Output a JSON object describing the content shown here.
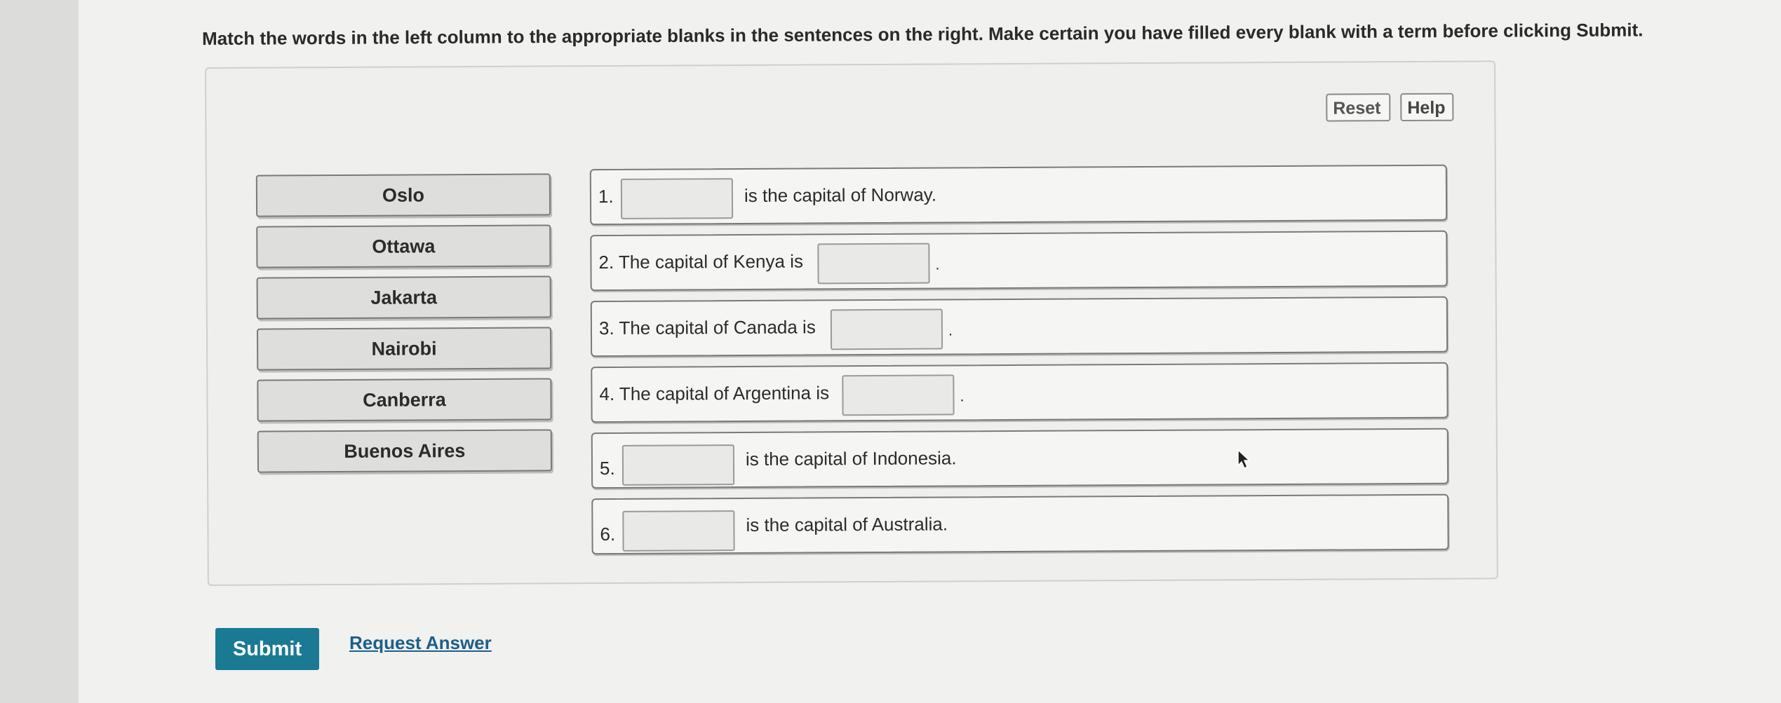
{
  "instructions": "Match the words in the left column to the appropriate blanks in the sentences on the right. Make certain you have filled every blank with a term before clicking Submit.",
  "toolbar": {
    "reset_label": "Reset",
    "help_label": "Help"
  },
  "terms": [
    "Oslo",
    "Ottawa",
    "Jakarta",
    "Nairobi",
    "Canberra",
    "Buenos Aires"
  ],
  "sentences": [
    {
      "number": "1.",
      "after": "is the capital of Norway."
    },
    {
      "before": "2. The capital of Kenya is",
      "period": "."
    },
    {
      "before": "3. The capital of Canada is",
      "period": "."
    },
    {
      "before": "4. The capital of Argentina is",
      "period": "."
    },
    {
      "number": "5.",
      "after": "is the capital of Indonesia."
    },
    {
      "number": "6.",
      "after": "is the capital of Australia."
    }
  ],
  "footer": {
    "submit_label": "Submit",
    "request_answer_label": "Request Answer"
  },
  "colors": {
    "submit_bg": "#1a7a94",
    "link": "#1b5f8a"
  }
}
